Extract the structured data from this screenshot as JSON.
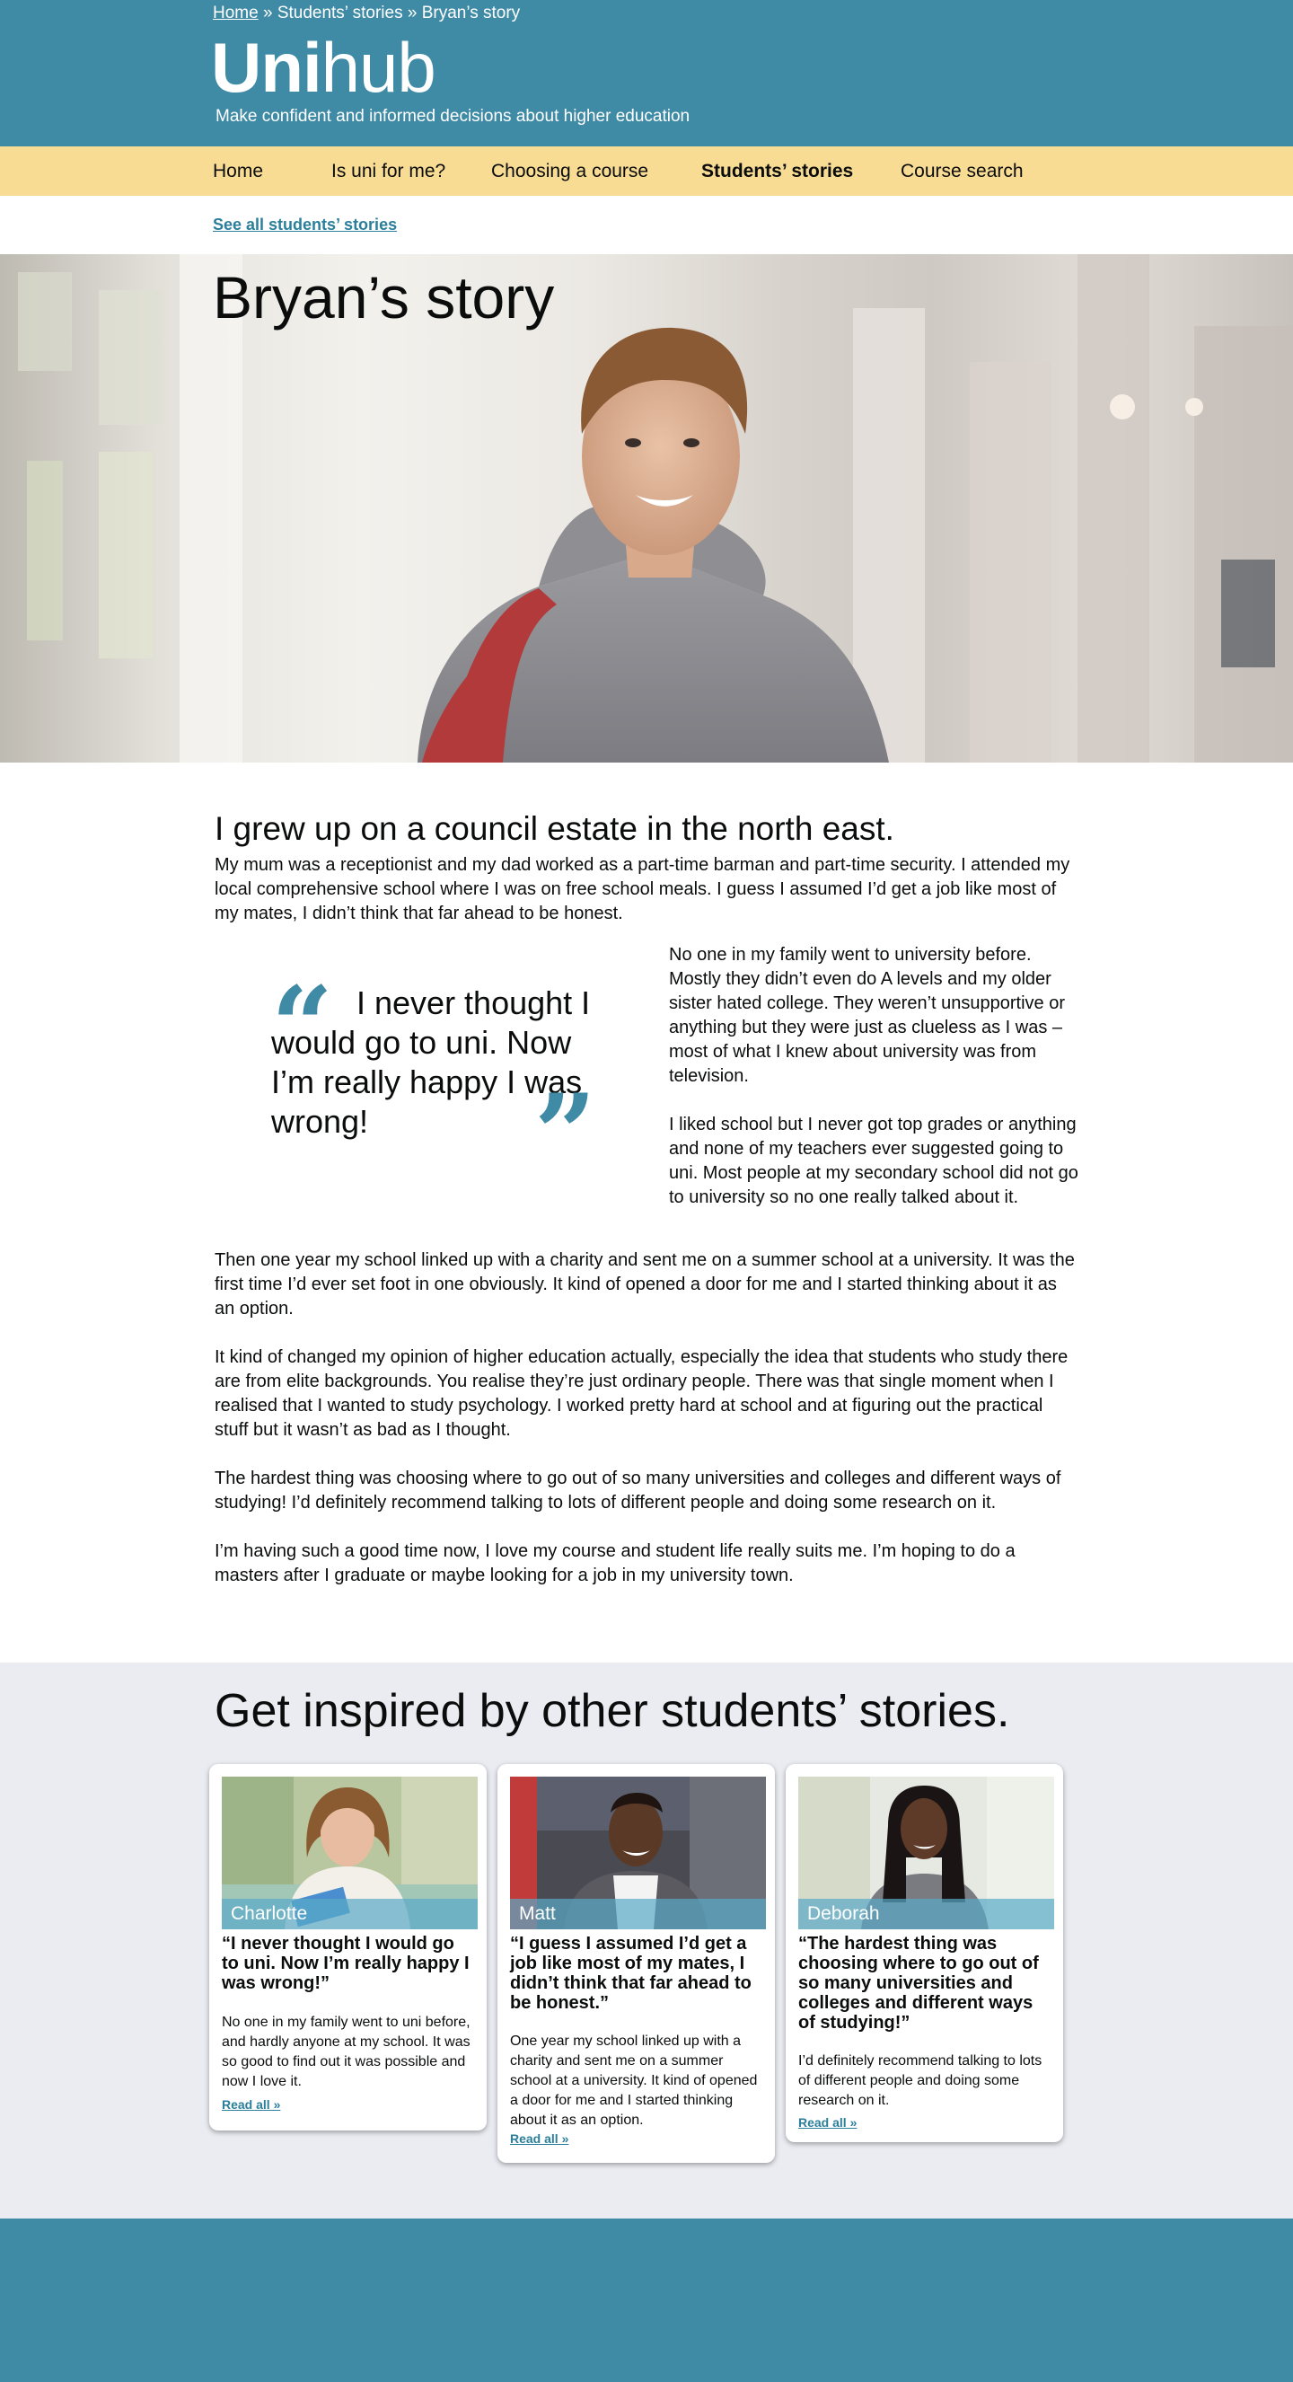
{
  "breadcrumb": {
    "home": "Home",
    "sep1": " » ",
    "stories": "Students’ stories",
    "sep2": " » ",
    "current": "Bryan’s story"
  },
  "brand": {
    "name_bold": "Uni",
    "name_light": "hub",
    "tagline": "Make confident and informed decisions about higher education"
  },
  "nav": {
    "items": [
      {
        "label": "Home"
      },
      {
        "label": "Is uni for me?"
      },
      {
        "label": "Choosing a course"
      },
      {
        "label": "Students’ stories"
      },
      {
        "label": "Course search"
      }
    ],
    "active": "Students’ stories"
  },
  "see_all": "See all students’ stories",
  "hero": {
    "title": "Bryan’s story"
  },
  "article": {
    "heading": "I grew up on a council estate in the north east.",
    "p1": "My mum was a receptionist and my dad worked as a part-time barman and part-time security. I attended my local comprehensive school where I was on free school meals. I guess I assumed I’d get a job like most of my mates, I didn’t think that far ahead to be honest.",
    "quote": "I never thought I would go to uni. Now I’m really happy I was wrong!",
    "side1": "No one in my family went to university before. Mostly they didn’t even do A levels and my older sister hated college. They weren’t unsupportive or anything but they were just as clueless as I was – most of what I knew about university was from television.",
    "side2": "I liked school but I never got top grades or anything and none of my teachers ever suggested going to uni. Most people at my secondary school did not go to university so no one really talked about it.",
    "p2": "Then one year my school linked up with a charity and sent me on a summer school at a university. It was the first time I’d ever set foot in one obviously. It kind of opened a door for me and I started thinking about it as an option.",
    "p3": "It kind of changed my opinion of higher education actually, especially the idea that students who study there are from elite backgrounds. You realise they’re just ordinary people. There was that single moment when I realised that I wanted to study psychology. I worked pretty hard at school and at figuring out the practical stuff but it wasn’t as bad as I thought.",
    "p4": "The hardest thing was choosing where to go out of so many universities and colleges and different ways of studying! I’d definitely recommend talking to lots of different people and doing some research on it.",
    "p5": "I’m having such a good time now, I love my course and student life really suits me. I’m hoping to do a masters after I graduate or maybe looking for a job in my university town."
  },
  "inspired": {
    "heading": "Get inspired by other students’ stories.",
    "cards": [
      {
        "name": "Charlotte",
        "quote": "“I never thought I would go to uni. Now I’m really happy I was wrong!”",
        "body": "No one in my family went to uni before, and hardly anyone at my school. It was so good to find out it was possible and now I love it.",
        "link": "Read all »"
      },
      {
        "name": "Matt",
        "quote": "“I guess I assumed I’d get a job like most of my mates, I didn’t think that far ahead to be honest.”",
        "body": "One year my school linked up with a charity and sent me on a summer school at a university. It kind of opened a door for me and I started thinking about it as an option.",
        "link": "Read all »"
      },
      {
        "name": "Deborah",
        "quote": "“The hardest thing was choosing where to go out of so many universities and colleges and different ways of studying!”",
        "body": "I’d definitely recommend talking to lots of different people and doing some research on it.",
        "link": "Read all »"
      }
    ]
  },
  "colors": {
    "brand_teal": "#3f8ba6",
    "nav_yellow": "#f8dc94",
    "section_grey": "#eaecf2",
    "link": "#2b7f9b"
  }
}
